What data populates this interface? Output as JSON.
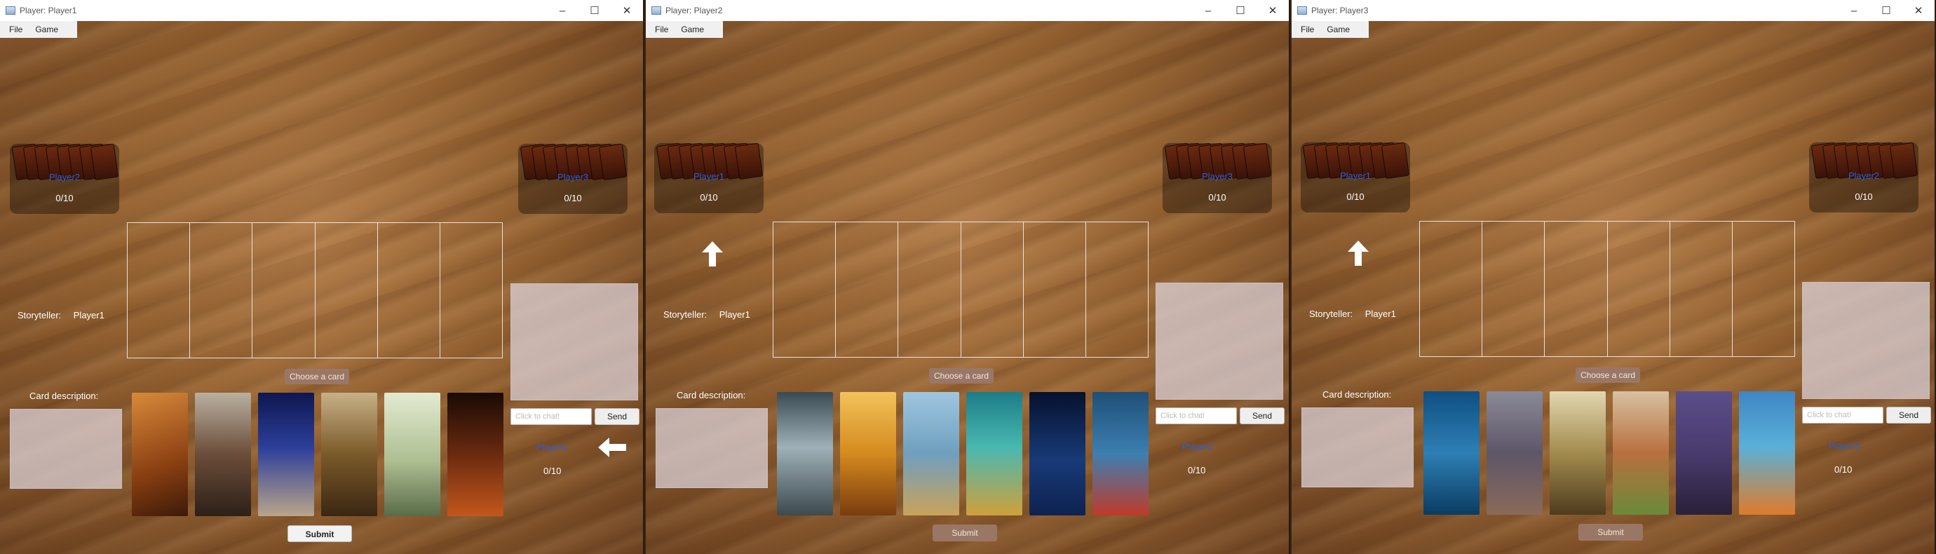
{
  "menu": {
    "file": "File",
    "game": "Game"
  },
  "labels": {
    "storyteller": "Storyteller:",
    "card_description": "Card description:",
    "choose_card": "Choose a card",
    "chat_placeholder": "Click to chat!",
    "send": "Send",
    "submit": "Submit"
  },
  "windows": [
    {
      "title": "Player: Player1",
      "opponents": [
        {
          "name": "Player2",
          "score": "0/10"
        },
        {
          "name": "Player3",
          "score": "0/10"
        }
      ],
      "storyteller": "Player1",
      "self": {
        "name": "Player1",
        "score": "0/10"
      },
      "submit_enabled": true,
      "indicator": "arrow-left",
      "hand_colors": [
        "#b0601f",
        "#6c4f3a",
        "#1e2a78",
        "#7d5a2a",
        "#c9d6b0",
        "#3a1c0e"
      ]
    },
    {
      "title": "Player: Player2",
      "opponents": [
        {
          "name": "Player1",
          "score": "0/10"
        },
        {
          "name": "Player3",
          "score": "0/10"
        }
      ],
      "storyteller": "Player1",
      "self": {
        "name": "Player2",
        "score": "0/10"
      },
      "submit_enabled": false,
      "indicator": "arrow-up",
      "hand_colors": [
        "#5f6f76",
        "#d48a1e",
        "#6f9fbe",
        "#2e9c9e",
        "#0e2250",
        "#1f4f78"
      ]
    },
    {
      "title": "Player: Player3",
      "opponents": [
        {
          "name": "Player1",
          "score": "0/10"
        },
        {
          "name": "Player2",
          "score": "0/10"
        }
      ],
      "storyteller": "Player1",
      "self": {
        "name": "Player3",
        "score": "0/10"
      },
      "submit_enabled": false,
      "indicator": "arrow-up",
      "hand_colors": [
        "#1f5f8c",
        "#6a6670",
        "#a38b4e",
        "#b7703f",
        "#4a3b6e",
        "#3f86c4"
      ]
    }
  ]
}
